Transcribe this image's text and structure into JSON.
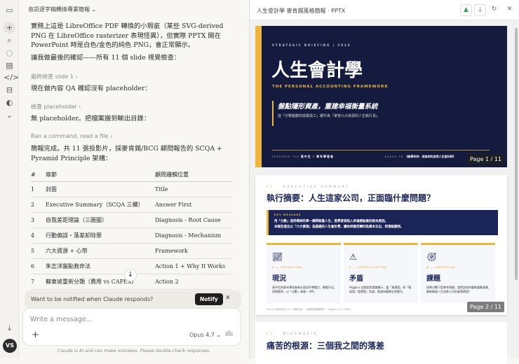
{
  "chat": {
    "title": "音訊逐字稿轉換專業簡報",
    "messages": [
      "實務上這是 LibreOffice PDF 轉換的小瑕疵（某些 SVG-derived PNG 在 LibreOffice rasterizer 表現怪異），但實際 PPTX 開在 PowerPoint 時是白色/金色的純色 PNG，會正常顯示。",
      "讓我做最後的確認——所有 11 個 slide 視覺檢查：",
      "現在做內容 QA 確認沒有 placeholder：",
      "無 placeholder。把檔案搬到輸出目錄：",
      "簡報完成。共 11 張投影片，採麥肯錫/BCG 顧問報告的 SCQA + Pyramid Principle 架構："
    ],
    "tools": [
      "最終檢查 slide 1 ›",
      "檢查 placeholder ›",
      "Ran a command, read a file ›"
    ],
    "table": {
      "headers": [
        "#",
        "章節",
        "顧問邏輯位置"
      ],
      "rows": [
        [
          "1",
          "封面",
          "Title"
        ],
        [
          "2",
          "Executive Summary（SCQA 三欄）",
          "Answer First"
        ],
        [
          "3",
          "自我差距理論（三圓圖）",
          "Diagnosis - Root Cause"
        ],
        [
          "4",
          "行動偏誤・落差卸除罪",
          "Diagnosis - Mechanism"
        ],
        [
          "5",
          "六大資源 + 心幣",
          "Framework"
        ],
        [
          "6",
          "朱志洋盤點救命法",
          "Action 1 + Why It Works"
        ],
        [
          "7",
          "蘇東坡重新分類（費用 vs CAPEX）",
          "Action 2"
        ]
      ]
    },
    "notify": {
      "text": "Want to be notified when Claude responds?",
      "button": "Notify"
    },
    "input_placeholder": "Write a message...",
    "model": "Opus 4.7",
    "footer": "Claude is AI and can make mistakes. Please double-check responses.",
    "avatar": "VS"
  },
  "panel": {
    "title": "人生會計學 麥肯錫風格簡報 · PPTX",
    "slide1": {
      "kicker": "STRATEGIC BRIEFING  |  2026",
      "title": "人生會計學",
      "subtitle": "THE PERSONAL ACCOUNTING FRAMEWORK",
      "tagline": "盤點隱形資產，重建幸福衡量系統",
      "desc": "從「分數驅動的底層員工」躍升為「掌管六大資源的人生執行長」",
      "prepared_label": "PREPARED FOR",
      "prepared": "高中生 / 青年學習者",
      "based_label": "BASED ON",
      "based": "《給青年的：成為你的自我人生會計師》",
      "page": "Page 1 / 11"
    },
    "slide2": {
      "num": "01",
      "section": "EXECUTIVE SUMMARY",
      "title": "執行摘要：人生這家公司，正面臨什麼問題？",
      "key_label": "KEY MESSAGE",
      "key1": "用「分數」這把壞掉的單一標桿衡量人生，是學習者陷入幸福感破產的根本原因。",
      "key2": "本報告提出以「六大資源」為基礎的人生會計學，讓你把痛苦轉列為資本支出、把潛能變現。",
      "cards": [
        {
          "label": "S — SITUATION",
          "title": "現況",
          "body": "高中生與青年學習者每天面對升學壓力，睡眠不足、同儕競爭，以「分數」為唯一 KPI。"
        },
        {
          "label": "C — COMPLICATION",
          "title": "矛盾",
          "body": "Higgins 自我差距理論顯示，當「真實我」與「應該我／理想我」失調，焦慮與憂鬱必然產生。"
        },
        {
          "label": "Q — QUESTION",
          "title": "課題",
          "body": "如果分數只是參考指標，我們該如何重新盤點資產，重新衡量人生這家公司的真實價值？"
        }
      ],
      "source": "Source: 給青年的 E.X.T. 演講內容 ・ 自我差距理論研究 ・ Higgins, E.T. (1987)",
      "page": "Page 2 / 11"
    },
    "slide3": {
      "num": "02",
      "section": "DIAGNOSIS",
      "title": "痛苦的根源：三個我之間的落差"
    }
  }
}
